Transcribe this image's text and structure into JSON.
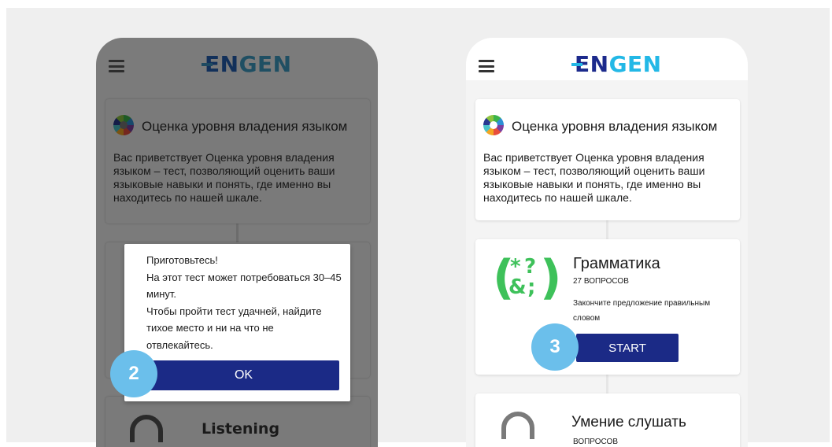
{
  "colors": {
    "brand_navy": "#1b2a86",
    "brand_cyan": "#23b8e6",
    "step_badge": "#6bbfeb",
    "grammar_green": "#3ec15a",
    "overlay_dim": "#7b7b7b"
  },
  "icons": {
    "menu": "hamburger-icon",
    "assessment": "color-wheel-icon",
    "grammar": "grammar-symbols-icon",
    "listening": "headphones-icon"
  },
  "logo": {
    "part1": "EN",
    "part2": "GEN"
  },
  "intro": {
    "title": "Оценка уровня владения языком",
    "text": "Вас приветствует Оценка уровня владения языком – тест, позволяющий оценить ваши языковые навыки и понять, где именно вы находитесь по нашей шкале."
  },
  "dialog": {
    "line1": "Приготовьтесь!",
    "line2": "На этот тест может потребоваться 30–45 минут.",
    "line3": "Чтобы пройти тест удачней, найдите тихое место и ни на что не отвлекайтесь.",
    "ok_label": "OK"
  },
  "steps": {
    "left": "2",
    "right": "3"
  },
  "grammar": {
    "title": "Грамматика",
    "count": "27 ВОПРОСОВ",
    "desc": "Закончите предложение правильным словом",
    "start_label": "START",
    "symbols": {
      "s1": "*",
      "s2": "?",
      "s3": "&",
      "s4": ";"
    },
    "paren_open": "(",
    "paren_close": ")"
  },
  "listening": {
    "left_title": "Listening",
    "right_title": "Умение слушать",
    "right_count": "ВОПРОСОВ"
  }
}
